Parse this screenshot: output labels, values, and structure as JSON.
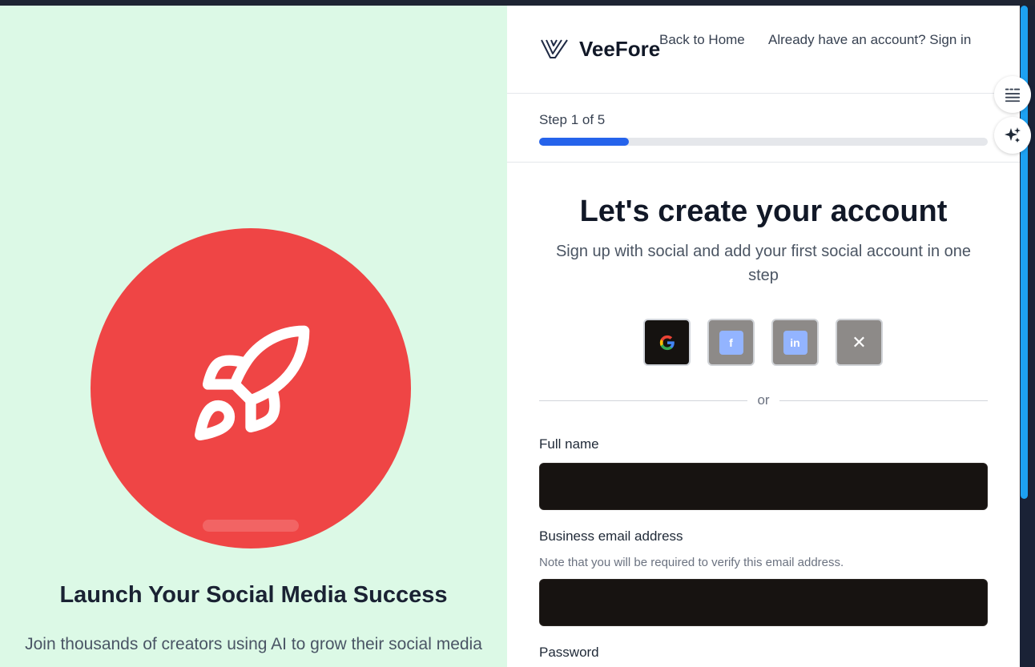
{
  "brand": {
    "name": "VeeFore"
  },
  "header": {
    "back_label": "Back to Home",
    "signin_label": "Already have an account? Sign in"
  },
  "progress": {
    "step_label": "Step 1 of 5",
    "fraction": 0.2
  },
  "main": {
    "title": "Let's create your account",
    "subtitle": "Sign up with social and add your first social account in one step"
  },
  "social": {
    "facebook_glyph": "f",
    "linkedin_glyph": "in",
    "x_glyph": "✕"
  },
  "divider": {
    "text": "or"
  },
  "form": {
    "full_name_label": "Full name",
    "full_name_value": "",
    "email_label": "Business email address",
    "email_hint": "Note that you will be required to verify this email address.",
    "email_value": "",
    "password_label": "Password"
  },
  "hero": {
    "title": "Launch Your Social Media Success",
    "subtitle": "Join thousands of creators using AI to grow their social media"
  },
  "colors": {
    "accent": "#2563eb",
    "hero_bg": "#dcf9e6",
    "hero_circle": "#ef4545",
    "scrollbar": "#1da1f2"
  }
}
